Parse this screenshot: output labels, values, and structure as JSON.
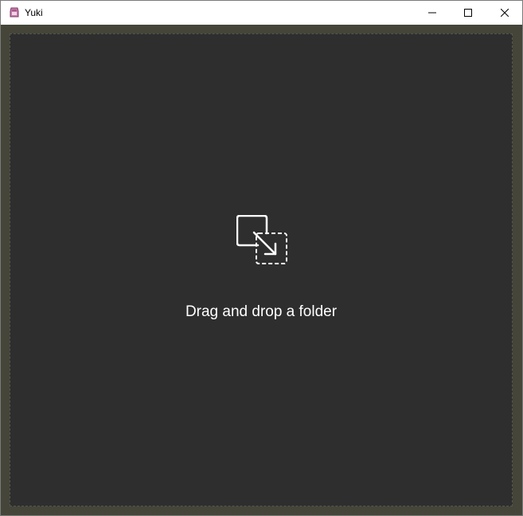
{
  "window": {
    "title": "Yuki",
    "app_icon": "yuki-app-icon",
    "controls": {
      "minimize_icon": "minimize-icon",
      "maximize_icon": "maximize-icon",
      "close_icon": "close-icon"
    }
  },
  "dropzone": {
    "icon": "drag-drop-icon",
    "label": "Drag and drop a folder"
  },
  "colors": {
    "frame_background": "#45453a",
    "dropzone_background": "#2e2e2e",
    "label_color": "#ffffff"
  }
}
